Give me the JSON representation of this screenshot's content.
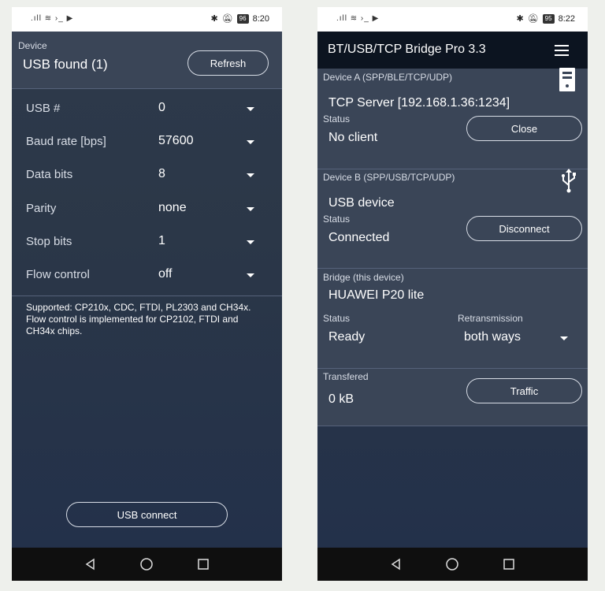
{
  "left_phone": {
    "status_bar": {
      "left_icons": ".ıll ≋ ›_ ▶",
      "battery": "96",
      "time": "8:20"
    },
    "device_label": "Device",
    "device_value": "USB found (1)",
    "refresh_label": "Refresh",
    "settings": [
      {
        "label": "USB #",
        "value": "0"
      },
      {
        "label": "Baud rate [bps]",
        "value": "57600"
      },
      {
        "label": "Data bits",
        "value": "8"
      },
      {
        "label": "Parity",
        "value": "none"
      },
      {
        "label": "Stop bits",
        "value": "1"
      },
      {
        "label": "Flow control",
        "value": "off"
      }
    ],
    "note_line1": "Supported: CP210x, CDC, FTDI, PL2303 and CH34x.",
    "note_line2": "Flow control is implemented for CP2102, FTDI and CH34x chips.",
    "connect_label": "USB connect"
  },
  "right_phone": {
    "status_bar": {
      "left_icons": ".ıll ≋ ›_ ▶",
      "battery": "95",
      "time": "8:22"
    },
    "app_title": "BT/USB/TCP Bridge Pro 3.3",
    "device_a": {
      "label": "Device A (SPP/BLE/TCP/UDP)",
      "value": "TCP Server [192.168.1.36:1234]",
      "status_label": "Status",
      "status_value": "No client",
      "button_label": "Close"
    },
    "device_b": {
      "label": "Device B (SPP/USB/TCP/UDP)",
      "value": "USB device",
      "status_label": "Status",
      "status_value": "Connected",
      "button_label": "Disconnect"
    },
    "bridge": {
      "label": "Bridge (this device)",
      "value": "HUAWEI P20 lite",
      "status_label": "Status",
      "status_value": "Ready",
      "retrans_label": "Retransmission",
      "retrans_value": "both ways"
    },
    "transfer": {
      "label": "Transfered",
      "value": "0 kB",
      "button_label": "Traffic"
    }
  },
  "icons": {
    "server": "server-icon",
    "usb": "usb-icon",
    "menu": "menu-icon",
    "back": "back-icon",
    "home": "home-icon",
    "recents": "recents-icon"
  }
}
